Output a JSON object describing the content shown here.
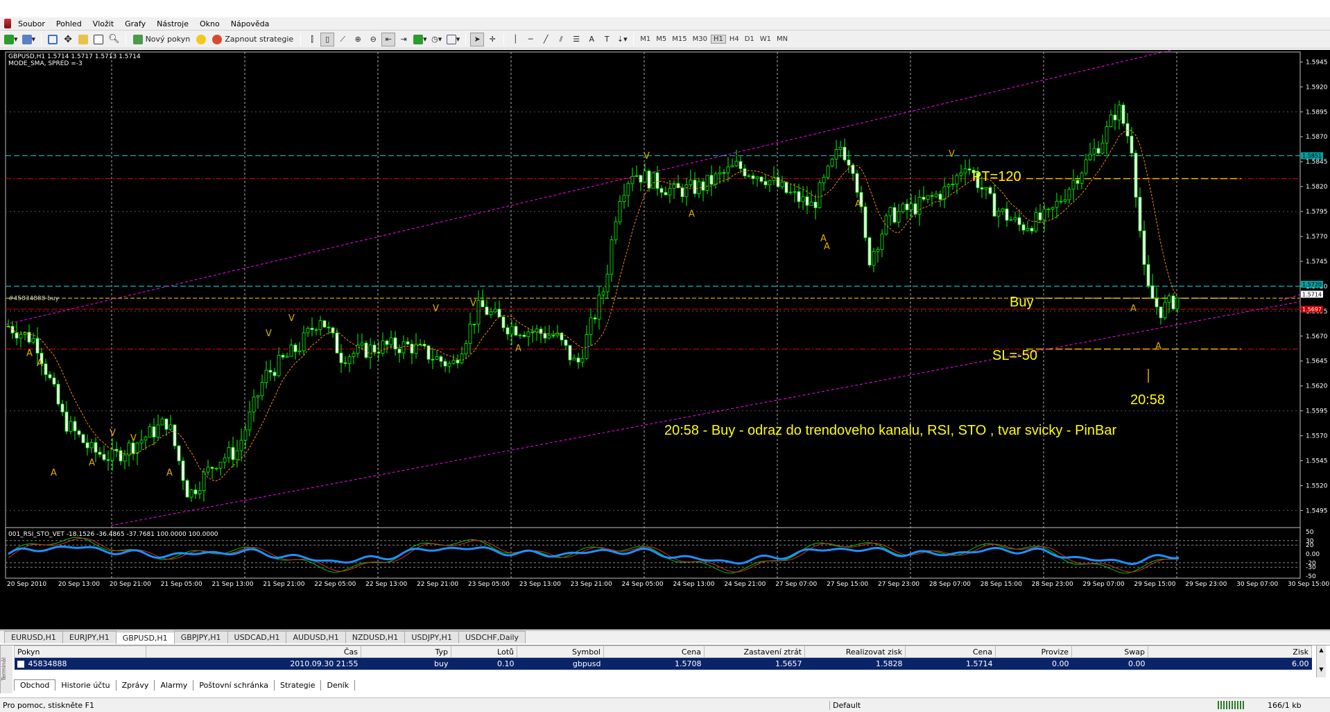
{
  "menu": {
    "items": [
      "Soubor",
      "Pohled",
      "Vložit",
      "Grafy",
      "Nástroje",
      "Okno",
      "Nápověda"
    ]
  },
  "toolbar": {
    "new_order": "Nový pokyn",
    "autotrading": "Zapnout strategie",
    "timeframes": [
      "M1",
      "M5",
      "M15",
      "M30",
      "H1",
      "H4",
      "D1",
      "W1",
      "MN"
    ],
    "active_tf": "H1"
  },
  "chart": {
    "header": "GBPUSD,H1  1.5714 1.5717 1.5713 1.5714",
    "subheader": "MODE_SMA, SPRED =-3",
    "order_label": "#45834888 buy",
    "indicator_header": "001_RSI_STO_VET -18.1526 -36.4865 -37.7681 100.0000 100.0000",
    "price_axis": [
      "1.5945",
      "1.5920",
      "1.5895",
      "1.5870",
      "1.5845",
      "1.5820",
      "1.5795",
      "1.5770",
      "1.5745",
      "1.5720",
      "1.5695",
      "1.5670",
      "1.5645",
      "1.5620",
      "1.5595",
      "1.5570",
      "1.5545",
      "1.5520",
      "1.5495"
    ],
    "price_tags": {
      "cyan_top": "1.5851",
      "cyan_mid": "1.5720",
      "ask": "1.5714",
      "red": "1.5697"
    },
    "ind_axis": [
      "50",
      "30",
      "20",
      "0.00",
      "-20",
      "-30",
      "-50"
    ],
    "time_axis": [
      "20 Sep 2010",
      "20 Sep 13:00",
      "20 Sep 21:00",
      "21 Sep 05:00",
      "21 Sep 13:00",
      "21 Sep 21:00",
      "22 Sep 05:00",
      "22 Sep 13:00",
      "22 Sep 21:00",
      "23 Sep 05:00",
      "23 Sep 13:00",
      "23 Sep 21:00",
      "24 Sep 05:00",
      "24 Sep 13:00",
      "24 Sep 21:00",
      "27 Sep 07:00",
      "27 Sep 15:00",
      "27 Sep 23:00",
      "28 Sep 07:00",
      "28 Sep 15:00",
      "28 Sep 23:00",
      "29 Sep 07:00",
      "29 Sep 15:00",
      "29 Sep 23:00",
      "30 Sep 07:00",
      "30 Sep 15:00"
    ],
    "annotations": {
      "pt": "PT=120",
      "buy": "Buy",
      "sl": "SL=-50",
      "time": "20:58",
      "comment": "20:58 - Buy - odraz do trendoveho kanalu, RSI, STO , tvar svicky - PinBar"
    },
    "colors": {
      "bull": "#00ff00",
      "bear": "#ffffff",
      "ma": "#ff8c00",
      "channel": "#ff00ff",
      "cyan": "#00c0c0",
      "red": "#c00000",
      "yellow": "#c8b000",
      "rsi": "#1e90ff",
      "annot": "#ffff00"
    }
  },
  "chart_tabs": [
    "EURUSD,H1",
    "EURJPY,H1",
    "GBPUSD,H1",
    "GBPJPY,H1",
    "USDCAD,H1",
    "AUDUSD,H1",
    "NZDUSD,H1",
    "USDJPY,H1",
    "USDCHF,Daily"
  ],
  "active_chart_tab": "GBPUSD,H1",
  "terminal": {
    "side_label": "Terminál",
    "columns": [
      "Pokyn",
      "Čas",
      "Typ",
      "Lotů",
      "Symbol",
      "Cena",
      "Zastavení ztrát",
      "Realizovat zisk",
      "Cena",
      "Provize",
      "Swap",
      "Zisk"
    ],
    "row": [
      "45834888",
      "2010.09.30 21:55",
      "buy",
      "0.10",
      "gbpusd",
      "1.5708",
      "1.5657",
      "1.5828",
      "1.5714",
      "0.00",
      "0.00",
      "6.00"
    ],
    "tabs": [
      "Obchod",
      "Historie účtu",
      "Zprávy",
      "Alarmy",
      "Poštovní schránka",
      "Strategie",
      "Deník"
    ],
    "active_tab": "Obchod"
  },
  "status": {
    "help": "Pro pomoc, stiskněte F1",
    "profile": "Default",
    "traffic": "166/1 kb"
  }
}
